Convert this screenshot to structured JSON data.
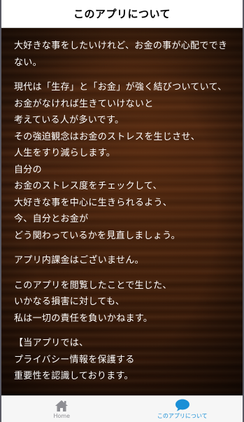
{
  "header": {
    "title": "このアプリについて"
  },
  "content": {
    "paragraphs": [
      [
        "大好きな事をしたいけれど、お金の事が心配でできない。"
      ],
      [
        "現代は「生存」と「お金」が強く結びついていて、",
        "お金がなければ生きていけないと",
        "考えている人が多いです。",
        "その強迫観念はお金のストレスを生じさせ、",
        "人生をすり減らします。",
        "自分の",
        "お金のストレス度をチェックして、",
        "大好きな事を中心に生きられるよう、",
        "今、自分とお金が",
        "どう関わっているかを見直しましょう。"
      ],
      [
        "アプリ内課金はございません。"
      ],
      [
        "このアプリを閲覧したことで生じた、",
        "いかなる損害に対しても、",
        "私は一切の責任を負いかねます。"
      ],
      [
        "【当アプリでは、",
        "プライバシー情報を保護する",
        "重要性を認識しております。"
      ]
    ]
  },
  "tabbar": {
    "tabs": [
      {
        "label": "Home",
        "icon": "home-icon",
        "active": false
      },
      {
        "label": "このアプリについて",
        "icon": "chat-bubble-icon",
        "active": true
      }
    ],
    "active_color": "#1a8fd6",
    "inactive_color": "#8e8e93"
  }
}
